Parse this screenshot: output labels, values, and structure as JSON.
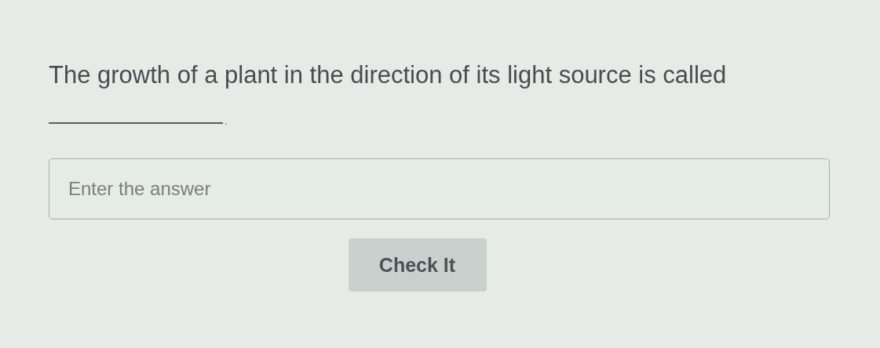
{
  "question": {
    "text": "The growth of a plant in the direction of its light source is called",
    "after_blank": "."
  },
  "answer": {
    "placeholder": "Enter the answer"
  },
  "button": {
    "label": "Check It"
  }
}
